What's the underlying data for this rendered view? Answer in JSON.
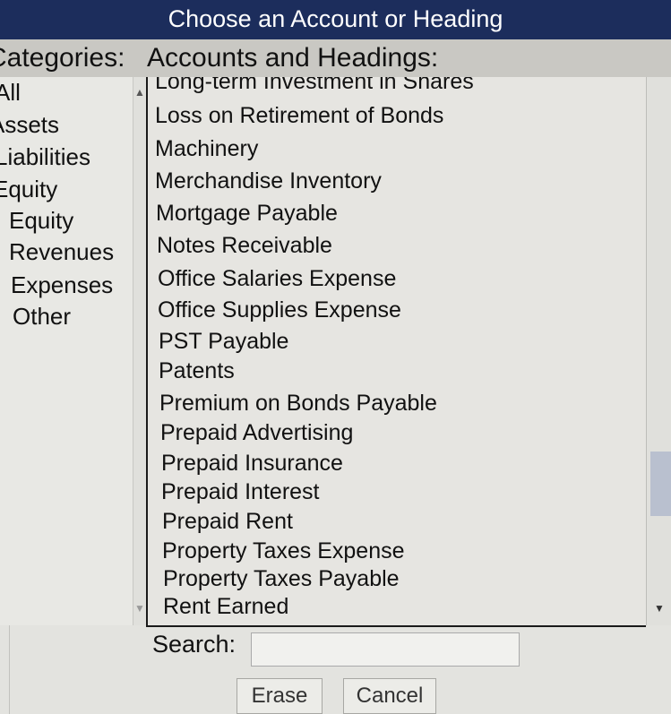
{
  "window": {
    "title": "Choose an Account or Heading"
  },
  "headings": {
    "categories": "Categories:",
    "accounts": "Accounts and Headings:"
  },
  "categories": [
    "All",
    "Assets",
    "Liabilities",
    "Equity",
    "Equity",
    "Revenues",
    "Expenses",
    "Other"
  ],
  "accounts": [
    "Long-term Investment in Shares",
    "Loss on Retirement of Bonds",
    "Machinery",
    "Merchandise Inventory",
    "Mortgage Payable",
    "Notes Receivable",
    "Office Salaries Expense",
    "Office Supplies Expense",
    "PST Payable",
    "Patents",
    "Premium on Bonds Payable",
    "Prepaid Advertising",
    "Prepaid Insurance",
    "Prepaid Interest",
    "Prepaid Rent",
    "Property Taxes Expense",
    "Property Taxes Payable",
    "Rent Earned"
  ],
  "search": {
    "label": "Search:",
    "value": ""
  },
  "buttons": {
    "erase": "Erase",
    "cancel": "Cancel"
  },
  "icons": {
    "scroll_up": "scroll-up-arrow-icon",
    "scroll_down": "scroll-down-arrow-icon"
  },
  "colors": {
    "title_bar": "#1c2d5c",
    "headings_bar": "#c9c8c3",
    "scroll_thumb": "#b9c0cf"
  }
}
